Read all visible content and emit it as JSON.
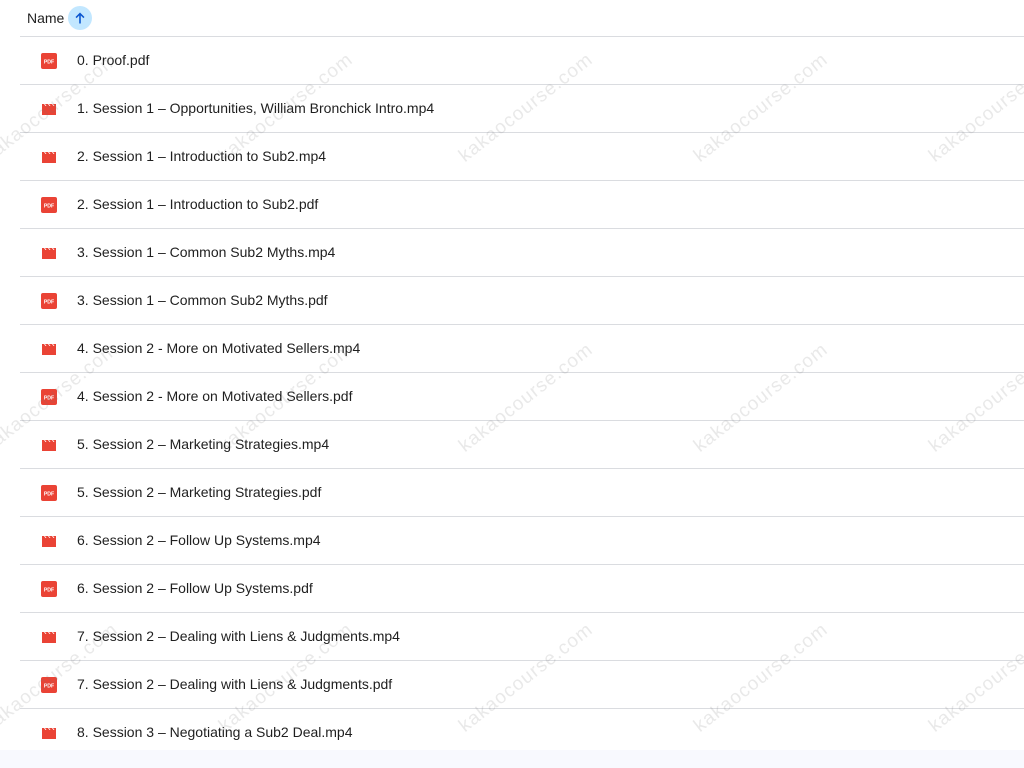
{
  "header": {
    "name_label": "Name",
    "sort_icon": "arrow-up-icon"
  },
  "files": [
    {
      "name": "0. Proof.pdf",
      "type": "pdf"
    },
    {
      "name": "1. Session 1 – Opportunities, William Bronchick Intro.mp4",
      "type": "video"
    },
    {
      "name": "2. Session 1 – Introduction to Sub2.mp4",
      "type": "video"
    },
    {
      "name": "2. Session 1 – Introduction to Sub2.pdf",
      "type": "pdf"
    },
    {
      "name": "3. Session 1 – Common Sub2 Myths.mp4",
      "type": "video"
    },
    {
      "name": "3. Session 1 – Common Sub2 Myths.pdf",
      "type": "pdf"
    },
    {
      "name": "4. Session 2 - More on Motivated Sellers.mp4",
      "type": "video"
    },
    {
      "name": "4. Session 2 - More on Motivated Sellers.pdf",
      "type": "pdf"
    },
    {
      "name": "5. Session 2 – Marketing Strategies.mp4",
      "type": "video"
    },
    {
      "name": "5. Session 2 – Marketing Strategies.pdf",
      "type": "pdf"
    },
    {
      "name": "6. Session 2 – Follow Up Systems.mp4",
      "type": "video"
    },
    {
      "name": "6. Session 2 – Follow Up Systems.pdf",
      "type": "pdf"
    },
    {
      "name": "7. Session 2 – Dealing with Liens & Judgments.mp4",
      "type": "video"
    },
    {
      "name": "7. Session 2 – Dealing with Liens & Judgments.pdf",
      "type": "pdf"
    },
    {
      "name": "8. Session 3 – Negotiating a Sub2 Deal.mp4",
      "type": "video"
    }
  ],
  "icons": {
    "pdf_badge_text": "PDF",
    "pdf_color": "#ea4335",
    "video_color": "#ea4335"
  },
  "watermark": {
    "text": "kakaocourse.com"
  }
}
